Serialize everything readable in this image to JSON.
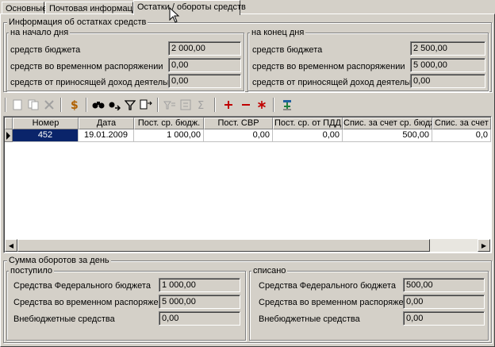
{
  "tabs": [
    {
      "label": "Основные"
    },
    {
      "label": "Почтовая информация"
    },
    {
      "label": "Остатки / обороты средств"
    }
  ],
  "balances": {
    "title": "Информация об остатках средств",
    "start": {
      "title": "на начало дня",
      "rows": [
        {
          "label": "средств бюджета",
          "value": "2 000,00"
        },
        {
          "label": "средств во временном распоряжении",
          "value": "0,00"
        },
        {
          "label": "средств от приносящей доход деятельности",
          "value": "0,00"
        }
      ]
    },
    "end": {
      "title": "на конец дня",
      "rows": [
        {
          "label": "средств бюджета",
          "value": "2 500,00"
        },
        {
          "label": "средств во временном распоряжении",
          "value": "5 000,00"
        },
        {
          "label": "средств от приносящей доход деятельности",
          "value": "0,00"
        }
      ]
    }
  },
  "toolbar": {
    "icons": [
      "new-icon",
      "copy-icon",
      "delete-icon",
      "money-icon",
      "find-icon",
      "find-next-icon",
      "filter-icon",
      "export-icon",
      "filter-edit-icon",
      "calc-icon",
      "sum-icon",
      "add-icon",
      "remove-icon",
      "asterisk-icon",
      "pin-icon"
    ],
    "accent_color": "#c00000"
  },
  "grid": {
    "columns": [
      "Номер",
      "Дата",
      "Пост. ср. бюдж.",
      "Пост. СВР",
      "Пост. ср. от  ПДД",
      "Спис. за счет ср. бюдж.",
      "Спис. за счет СВР"
    ],
    "rows": [
      [
        "452",
        "19.01.2009",
        "1 000,00",
        "0,00",
        "0,00",
        "500,00",
        "0,0"
      ]
    ]
  },
  "turnover": {
    "title": "Сумма оборотов за день",
    "received": {
      "title": "поступило",
      "rows": [
        {
          "label": "Средства Федерального бюджета",
          "value": "1 000,00"
        },
        {
          "label": "Средства во временном распоряжении",
          "value": "5 000,00"
        },
        {
          "label": "Внебюджетные средства",
          "value": "0,00"
        }
      ]
    },
    "written_off": {
      "title": "списано",
      "rows": [
        {
          "label": "Средства Федерального бюджета",
          "value": "500,00"
        },
        {
          "label": "Средства во временном распоряжении",
          "value": "0,00"
        },
        {
          "label": "Внебюджетные средства",
          "value": "0,00"
        }
      ]
    }
  }
}
